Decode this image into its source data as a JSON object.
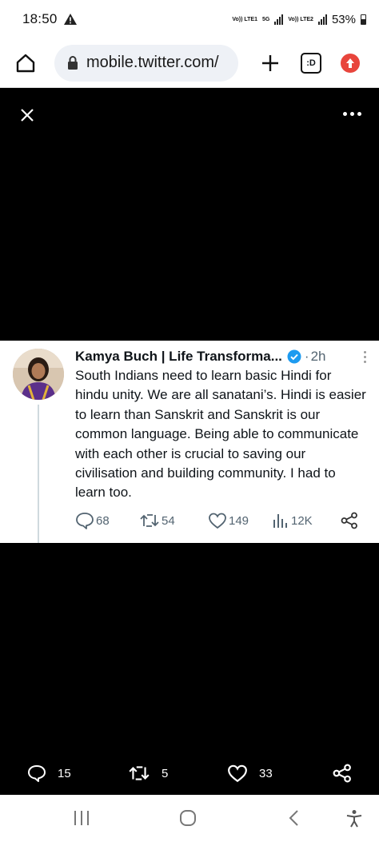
{
  "status_bar": {
    "time": "18:50",
    "battery": "53%",
    "network": "5G",
    "volte1": "Vo)) LTE1",
    "volte2": "Vo)) LTE2"
  },
  "browser": {
    "url": "mobile.twitter.com/",
    "tabs_label": ":D"
  },
  "tweet": {
    "author": "Kamya Buch | Life Transforma...",
    "separator": "·",
    "time": "2h",
    "text": "South Indians need to learn basic Hindi for hindu unity. We are all sanatani’s. Hindi is easier to learn than Sanskrit and Sanskrit is our common language. Being able to communicate with each other is crucial to saving our civilisation and building community. I had to learn too.",
    "replies": "68",
    "retweets": "54",
    "likes": "149",
    "views": "12K"
  },
  "media_actions": {
    "replies": "15",
    "retweets": "5",
    "likes": "33"
  },
  "colors": {
    "accent": "#1d9bf0",
    "update_badge": "#e8453c",
    "muted_text": "#536471"
  }
}
